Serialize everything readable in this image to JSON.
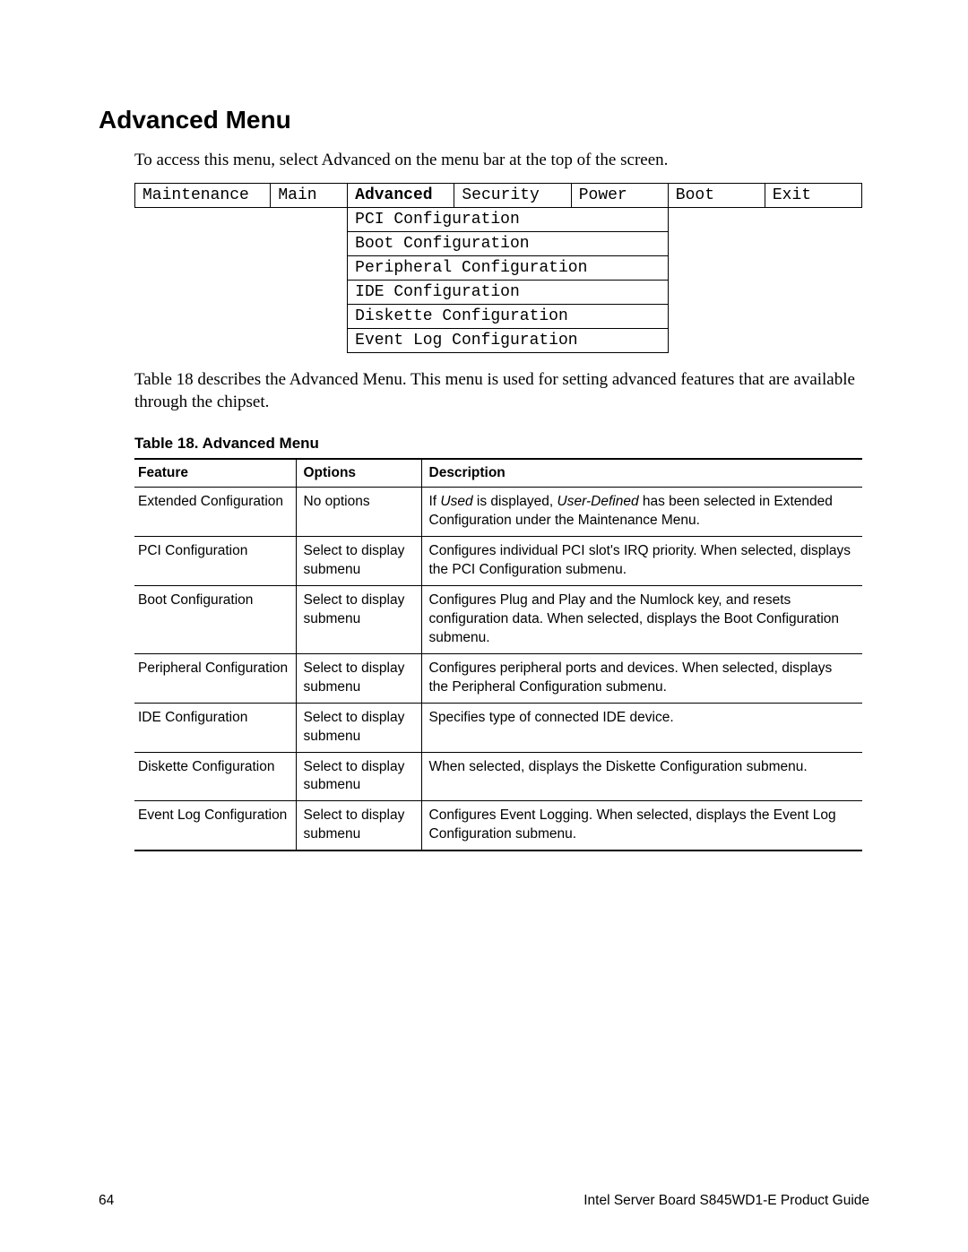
{
  "heading": "Advanced Menu",
  "intro": "To access this menu, select Advanced on the menu bar at the top of the screen.",
  "menuBar": {
    "items": [
      "Maintenance",
      "Main",
      "Advanced",
      "Security",
      "Power",
      "Boot",
      "Exit"
    ],
    "activeIndex": 2
  },
  "submenu": [
    "PCI Configuration",
    "Boot Configuration",
    "Peripheral Configuration",
    "IDE Configuration",
    "Diskette Configuration",
    "Event Log Configuration"
  ],
  "description": "Table 18 describes the Advanced Menu.  This menu is used for setting advanced features that are available through the chipset.",
  "tableCaption": "Table 18.    Advanced Menu",
  "featureTable": {
    "headers": [
      "Feature",
      "Options",
      "Description"
    ],
    "rows": [
      {
        "feature": "Extended Configuration",
        "options": "No options",
        "desc_pre": "If ",
        "desc_it1": "Used",
        "desc_mid": " is displayed, ",
        "desc_it2": "User-Defined",
        "desc_post": " has been selected in Extended Configuration under the Maintenance Menu."
      },
      {
        "feature": "PCI Configuration",
        "options": "Select to display submenu",
        "description": "Configures individual PCI slot's IRQ priority.  When selected, displays the PCI Configuration submenu."
      },
      {
        "feature": "Boot Configuration",
        "options": "Select to display submenu",
        "description": "Configures Plug and Play and the Numlock key, and resets configuration data.  When selected, displays the Boot Configuration submenu."
      },
      {
        "feature": "Peripheral Configuration",
        "options": "Select to display submenu",
        "description": "Configures peripheral ports and devices.  When selected, displays the Peripheral Configuration submenu."
      },
      {
        "feature": "IDE Configuration",
        "options": "Select to display submenu",
        "description": "Specifies type of connected IDE device."
      },
      {
        "feature": "Diskette Configuration",
        "options": "Select to display submenu",
        "description": "When selected, displays the Diskette Configuration submenu."
      },
      {
        "feature": "Event Log Configuration",
        "options": "Select to display submenu",
        "description": "Configures Event Logging.  When selected, displays the Event Log Configuration submenu."
      }
    ]
  },
  "footer": {
    "pageNumber": "64",
    "docTitle": "Intel Server Board S845WD1-E Product Guide"
  }
}
